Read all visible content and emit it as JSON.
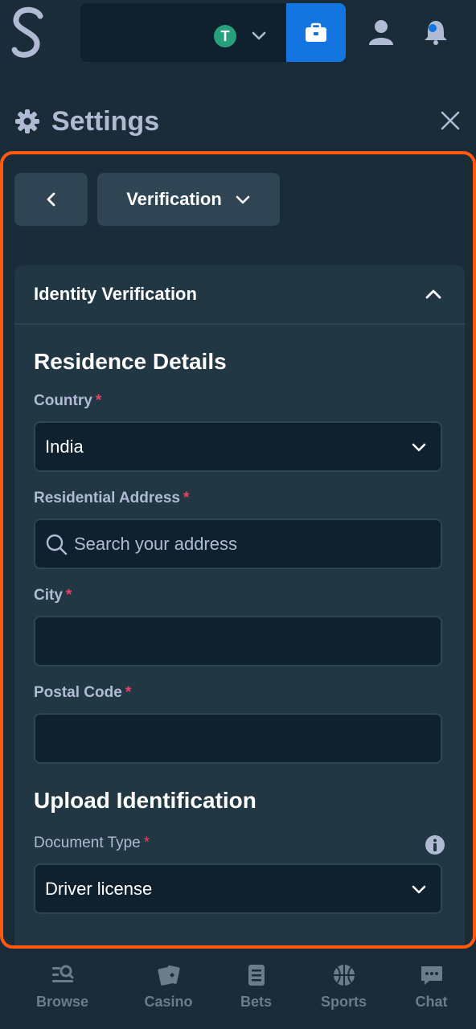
{
  "header": {
    "currency": "T"
  },
  "settings": {
    "title": "Settings"
  },
  "nav": {
    "section": "Verification"
  },
  "card": {
    "title": "Identity Verification",
    "residence_heading": "Residence Details",
    "country_label": "Country",
    "country_value": "India",
    "address_label": "Residential Address",
    "address_placeholder": "Search your address",
    "city_label": "City",
    "city_value": "",
    "postal_label": "Postal Code",
    "postal_value": "",
    "upload_heading": "Upload Identification",
    "doctype_label": "Document Type",
    "doctype_value": "Driver license",
    "required_mark": "*"
  },
  "bottom_nav": [
    "Browse",
    "Casino",
    "Bets",
    "Sports",
    "Chat"
  ],
  "colors": {
    "background": "#1a2c38",
    "card": "#213743",
    "input": "#0f212e",
    "accent_blue": "#1475e1",
    "highlight": "#ff5a10",
    "required": "#ed4163",
    "tether": "#26a17b"
  }
}
